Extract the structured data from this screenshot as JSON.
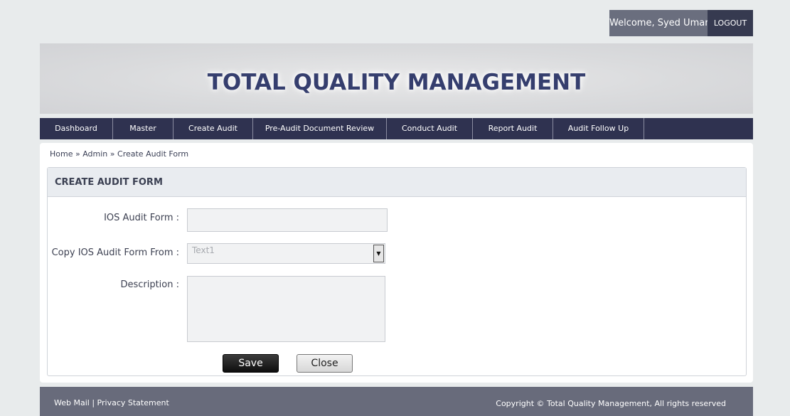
{
  "user": {
    "welcome": "Welcome, Syed Umar",
    "logout_label": "LOGOUT"
  },
  "banner": {
    "title": "TOTAL QUALITY MANAGEMENT"
  },
  "nav": {
    "items": [
      {
        "label": "Dashboard"
      },
      {
        "label": "Master"
      },
      {
        "label": "Create Audit"
      },
      {
        "label": "Pre-Audit Document Review"
      },
      {
        "label": "Conduct Audit"
      },
      {
        "label": "Report Audit"
      },
      {
        "label": "Audit Follow Up"
      }
    ]
  },
  "breadcrumb": {
    "home": "Home",
    "sep": "»",
    "admin": "Admin",
    "current": "Create Audit Form"
  },
  "form": {
    "heading": "CREATE AUDIT FORM",
    "ios_label": "IOS Audit Form :",
    "ios_value": "",
    "copy_label": "Copy IOS Audit Form From :",
    "copy_selected": "Text1",
    "description_label": "Description :",
    "description_value": "",
    "save_label": "Save",
    "close_label": "Close"
  },
  "footer": {
    "webmail": "Web Mail",
    "sep": "|",
    "privacy": "Privacy Statement",
    "copyright": "Copyright © Total Quality Management, All rights reserved"
  },
  "colors": {
    "nav_bg": "#2f3250",
    "title": "#353e6e",
    "footer_bg": "#686b7b",
    "welcome_bg": "#6a6e7e",
    "logout_bg": "#363a50"
  }
}
